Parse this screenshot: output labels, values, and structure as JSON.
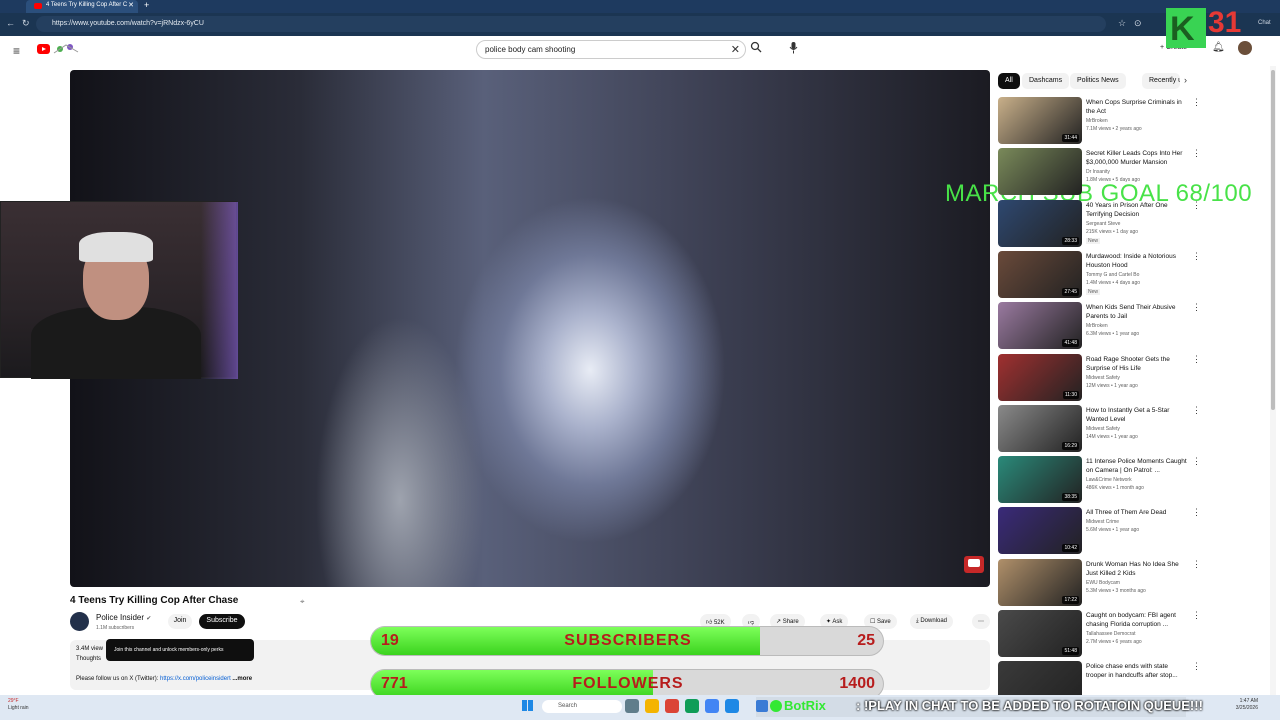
{
  "browser": {
    "tab_title": "4 Teens Try Killing Cop After C",
    "url": "https://www.youtube.com/watch?v=jRNdzx-6yCU",
    "chat_label": "Chat"
  },
  "header": {
    "search_value": "police body cam shooting",
    "create_label": "Create"
  },
  "overlay": {
    "k_letter": "K",
    "k_number": "31",
    "goal_text": "MARCH SUB GOAL 68/100",
    "subscribers": {
      "current": "19",
      "label": "SUBSCRIBERS",
      "goal": "25",
      "progress": 0.76
    },
    "followers": {
      "current": "771",
      "label": "FOLLOWERS",
      "goal": "1400",
      "progress": 0.55
    },
    "chat_user": "BotRix",
    "chat_message": ": !PLAY IN CHAT TO BE ADDED TO ROTATOIN QUEUE!!!"
  },
  "video": {
    "title": "4 Teens Try Killing Cop After Chase",
    "channel": "Police Insider",
    "channel_subs": "1.1M subscribers",
    "join_label": "Join",
    "subscribe_label": "Subscribe",
    "tooltip": "Join this channel and unlock members-only perks",
    "likes": "52K",
    "share_label": "Share",
    "ask_label": "Ask",
    "save_label": "Save",
    "download_label": "Download",
    "views": "3.4M view",
    "desc_line": "Thoughts",
    "follow_text": "Please follow us on X (Twitter):",
    "follow_link": "https://x.com/policeinsidert",
    "more_label": "...more"
  },
  "chips": [
    "All",
    "Dashcams",
    "Politics News",
    "Recently u"
  ],
  "recommendations": [
    {
      "title": "When Cops Surprise Criminals in the Act",
      "channel": "MrBroken",
      "meta": "7.1M views • 2 years ago",
      "duration": "31:44",
      "color": "#c9b08a",
      "is_new": false
    },
    {
      "title": "Secret Killer Leads Cops Into Her $3,000,000 Murder Mansion",
      "channel": "Dr Insanity",
      "meta": "1.8M views • 5 days ago",
      "duration": "",
      "color": "#7a8a5a",
      "is_new": false
    },
    {
      "title": "40 Years in Prison After One Terrifying Decision",
      "channel": "Sergeant Steve",
      "meta": "215K views • 1 day ago",
      "duration": "28:33",
      "color": "#2e4870",
      "is_new": true
    },
    {
      "title": "Murdawood: Inside a Notorious Houston Hood",
      "channel": "Tommy G and Cartel Bo",
      "meta": "1.4M views • 4 days ago",
      "duration": "27:45",
      "color": "#6a4a3a",
      "is_new": true
    },
    {
      "title": "When Kids Send Their Abusive Parents to Jail",
      "channel": "MrBroken",
      "meta": "6.3M views • 1 year ago",
      "duration": "41:48",
      "color": "#9a7aa0",
      "is_new": false
    },
    {
      "title": "Road Rage Shooter Gets the Surprise of His Life",
      "channel": "Midwest Safety",
      "meta": "12M views • 1 year ago",
      "duration": "11:30",
      "color": "#a03030",
      "is_new": false
    },
    {
      "title": "How to Instantly Get a 5-Star Wanted Level",
      "channel": "Midwest Safety",
      "meta": "14M views • 1 year ago",
      "duration": "16:29",
      "color": "#8a8a8a",
      "is_new": false
    },
    {
      "title": "11 Intense Police Moments Caught on Camera | On Patrol: ...",
      "channel": "Law&Crime Network",
      "meta": "486K views • 1 month ago",
      "duration": "38:35",
      "color": "#2a8a7a",
      "is_new": false
    },
    {
      "title": "All Three of Them Are Dead",
      "channel": "Midwest Crime",
      "meta": "5.6M views • 1 year ago",
      "duration": "10:42",
      "color": "#3a2a7a",
      "is_new": false
    },
    {
      "title": "Drunk Woman Has No Idea She Just Killed 2 Kids",
      "channel": "EWU Bodycam",
      "meta": "5.3M views • 3 months ago",
      "duration": "17:22",
      "color": "#b0906a",
      "is_new": false
    },
    {
      "title": "Caught on bodycam: FBI agent chasing Florida corruption ...",
      "channel": "Tallahassee Democrat",
      "meta": "2.7M views • 6 years ago",
      "duration": "51:48",
      "color": "#4a4a4a",
      "is_new": false
    },
    {
      "title": "Police chase ends with state trooper in handcuffs after stop...",
      "channel": "",
      "meta": "",
      "duration": "",
      "color": "#3a3a3a",
      "is_new": false
    }
  ],
  "taskbar": {
    "temp": "29°F",
    "weather": "Light rain",
    "search_label": "Search",
    "time": "1:47 AM",
    "date": "3/25/2026"
  }
}
